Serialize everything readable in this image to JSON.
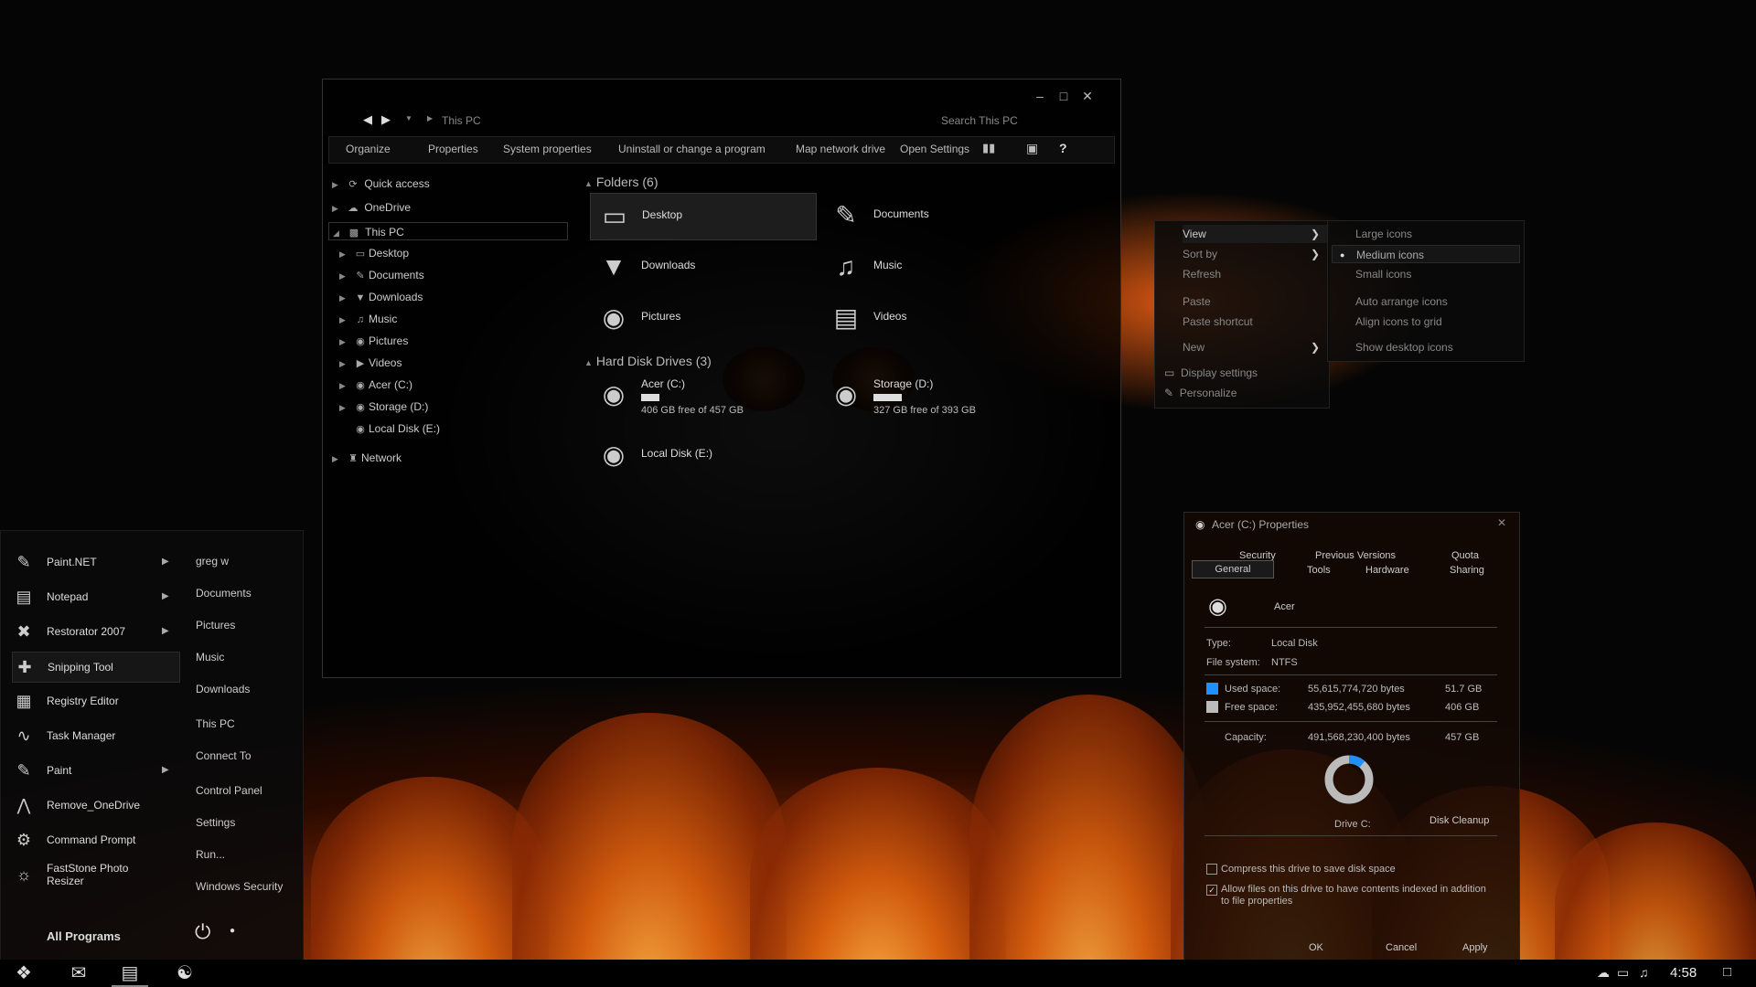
{
  "explorer": {
    "breadcrumb": "This PC",
    "search_placeholder": "Search This PC",
    "toolbar": [
      "Organize",
      "Properties",
      "System properties",
      "Uninstall or change a program",
      "Map network drive",
      "Open Settings"
    ],
    "help_label": "?",
    "nav": {
      "quick_access": "Quick access",
      "onedrive": "OneDrive",
      "this_pc": "This PC",
      "children": [
        "Desktop",
        "Documents",
        "Downloads",
        "Music",
        "Pictures",
        "Videos",
        "Acer (C:)",
        "Storage (D:)",
        "Local Disk (E:)"
      ],
      "network": "Network"
    },
    "folders_header": "Folders (6)",
    "folders": [
      "Desktop",
      "Documents",
      "Downloads",
      "Music",
      "Pictures",
      "Videos"
    ],
    "drives_header": "Hard Disk Drives (3)",
    "drives": [
      {
        "name": "Acer (C:)",
        "free": "406 GB free of 457 GB",
        "used_fraction": 0.11
      },
      {
        "name": "Storage (D:)",
        "free": "327 GB free of 393 GB",
        "used_fraction": 0.17
      },
      {
        "name": "Local Disk (E:)"
      }
    ]
  },
  "context_menu": {
    "items": [
      "View",
      "Sort by",
      "Refresh",
      "Paste",
      "Paste shortcut",
      "New",
      "Display settings",
      "Personalize"
    ],
    "view_submenu": [
      "Large icons",
      "Medium icons",
      "Small icons",
      "Auto arrange icons",
      "Align icons to grid",
      "Show desktop icons"
    ],
    "selected_view": "Medium icons"
  },
  "start_menu": {
    "apps": [
      "Paint.NET",
      "Notepad",
      "Restorator 2007",
      "Snipping Tool",
      "Registry Editor",
      "Task Manager",
      "Paint",
      "Remove_OneDrive",
      "Command Prompt",
      "FastStone Photo Resizer"
    ],
    "links": [
      "greg w",
      "Documents",
      "Pictures",
      "Music",
      "Downloads",
      "This PC",
      "Connect To",
      "Control Panel",
      "Settings",
      "Run...",
      "Windows Security"
    ],
    "all_programs": "All Programs"
  },
  "properties": {
    "title": "Acer (C:) Properties",
    "tabs_row1": [
      "Security",
      "Previous Versions",
      "Quota"
    ],
    "tabs_row2": [
      "General",
      "Tools",
      "Hardware",
      "Sharing"
    ],
    "drive_name": "Acer",
    "type_label": "Type:",
    "type_value": "Local Disk",
    "fs_label": "File system:",
    "fs_value": "NTFS",
    "used_label": "Used space:",
    "used_bytes": "55,615,774,720 bytes",
    "used_gb": "51.7 GB",
    "free_label": "Free space:",
    "free_bytes": "435,952,455,680 bytes",
    "free_gb": "406 GB",
    "cap_label": "Capacity:",
    "cap_bytes": "491,568,230,400 bytes",
    "cap_gb": "457 GB",
    "used_fraction": 0.113,
    "drive_label": "Drive C:",
    "disk_cleanup": "Disk Cleanup",
    "compress_label": "Compress this drive to save disk space",
    "index_label": "Allow files on this drive to have contents indexed in addition to file properties",
    "ok": "OK",
    "cancel": "Cancel",
    "apply": "Apply",
    "used_color": "#1e90ff",
    "free_color": "#bbbbbb"
  },
  "taskbar": {
    "time": "4:58"
  }
}
